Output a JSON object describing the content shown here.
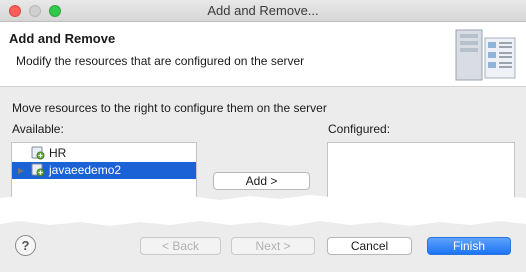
{
  "window": {
    "title": "Add and Remove..."
  },
  "header": {
    "title": "Add and Remove",
    "description": "Modify the resources that are configured on the server"
  },
  "instructions": "Move resources to the right to configure them on the server",
  "available": {
    "label": "Available:",
    "items": [
      {
        "label": "HR",
        "selected": false
      },
      {
        "label": "javaeedemo2",
        "selected": true
      }
    ]
  },
  "configured": {
    "label": "Configured:",
    "items": []
  },
  "buttons": {
    "add": "Add >",
    "back": "< Back",
    "next": "Next >",
    "cancel": "Cancel",
    "finish": "Finish",
    "help": "?"
  },
  "colors": {
    "selection": "#1b62d6",
    "finish_button": "#1b73f6"
  },
  "icons": [
    "server-icon",
    "web-module-icon",
    "help-icon"
  ]
}
